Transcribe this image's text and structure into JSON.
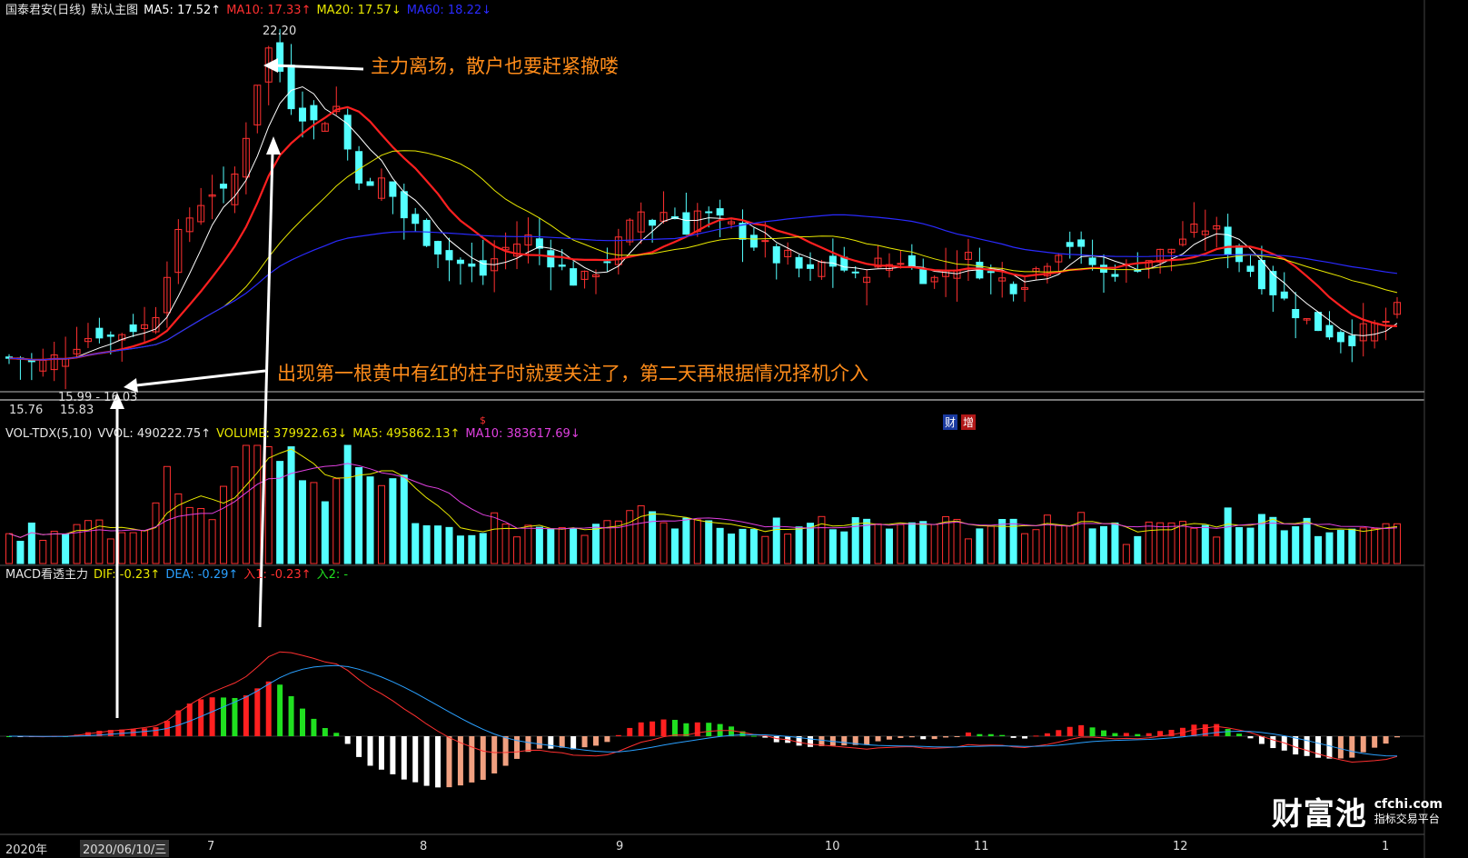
{
  "main_header": {
    "stock_name": "国泰君安(日线)",
    "chart_label": "默认主图",
    "ma5": "MA5: 17.52↑",
    "ma10": "MA10: 17.33↑",
    "ma20": "MA20: 17.57↓",
    "ma60": "MA60: 18.22↓"
  },
  "vol_header": {
    "name": "VOL-TDX(5,10)",
    "vvol": "VVOL: 490222.75↑",
    "volume": "VOLUME: 379922.63↓",
    "ma5": "MA5: 495862.13↑",
    "ma10": "MA10: 383617.69↓"
  },
  "macd_header": {
    "name": "MACD看透主力",
    "dif": "DIF: -0.23↑",
    "dea": "DEA: -0.29↑",
    "in1": "入1: -0.23↑",
    "in2": "入2: -"
  },
  "annotations": {
    "top": "主力离场，散户也要赶紧撤喽",
    "bottom": "出现第一根黄中有红的柱子时就要关注了，第二天再根据情况择机介入"
  },
  "price_labels": {
    "high": "22.20",
    "current_range": "15.99 - 16.03",
    "low_a": "15.76",
    "low_b": "15.83"
  },
  "markers": {
    "m1": "$",
    "m2": "财",
    "m3": "增"
  },
  "x_axis": {
    "year": "2020年",
    "cursor_date": "2020/06/10/三",
    "months": [
      "7",
      "8",
      "9",
      "10",
      "11",
      "12",
      "1"
    ]
  },
  "watermark": {
    "brand": "财富池",
    "domain": "cfchi.com",
    "tagline": "指标交易平台"
  },
  "colors": {
    "up": "#ff3030",
    "down": "#54ffff",
    "ma5": "#ffffff",
    "ma10": "#ff2020",
    "ma20": "#e8e800",
    "ma60": "#2a2aff",
    "dea": "#2aa0ff",
    "dif_line": "#ff3030",
    "annotation": "#ff8c1a"
  },
  "icons": {
    "arrow": "arrow-icon"
  },
  "chart_data": {
    "type": "candlestick",
    "x_range": [
      "2020-06",
      "2021-01"
    ],
    "y_range_price": [
      15.76,
      22.2
    ],
    "ohlc_profile": [
      16.1,
      16.1,
      16.0,
      16.0,
      16.1,
      16.2,
      16.4,
      16.5,
      16.6,
      16.5,
      16.6,
      16.7,
      16.7,
      17.0,
      17.8,
      18.4,
      18.8,
      19.1,
      19.3,
      19.2,
      19.6,
      20.4,
      21.4,
      22.0,
      21.6,
      21.0,
      20.8,
      20.6,
      20.7,
      20.9,
      20.1,
      19.6,
      19.3,
      19.5,
      19.2,
      18.8,
      18.6,
      18.4,
      18.2,
      18.0,
      17.9,
      17.8,
      17.7,
      18.0,
      18.2,
      18.3,
      18.4,
      18.2,
      18.0,
      17.8,
      17.6,
      17.6,
      17.8,
      18.0,
      18.3,
      18.6,
      18.9,
      18.7,
      18.9,
      18.8,
      18.6,
      18.9,
      18.8,
      18.7,
      18.6,
      18.5,
      18.3,
      18.2,
      18.0,
      18.0,
      17.8,
      17.7,
      17.9,
      17.9,
      17.8,
      17.6,
      17.8,
      17.9,
      17.9,
      18.0,
      17.8,
      17.7,
      17.6,
      17.8,
      17.9,
      18.0,
      17.8,
      17.7,
      17.6,
      17.5,
      17.6,
      17.8,
      18.0,
      18.2,
      18.3,
      18.1,
      17.9,
      17.7,
      17.8,
      17.8,
      17.9,
      18.0,
      18.1,
      18.2,
      18.4,
      18.5,
      18.6,
      18.5,
      18.2,
      18.0,
      17.8,
      17.6,
      17.4,
      17.2,
      17.0,
      16.8,
      16.7,
      16.6,
      16.5,
      16.5,
      16.6,
      16.7,
      16.8,
      17.0
    ]
  }
}
